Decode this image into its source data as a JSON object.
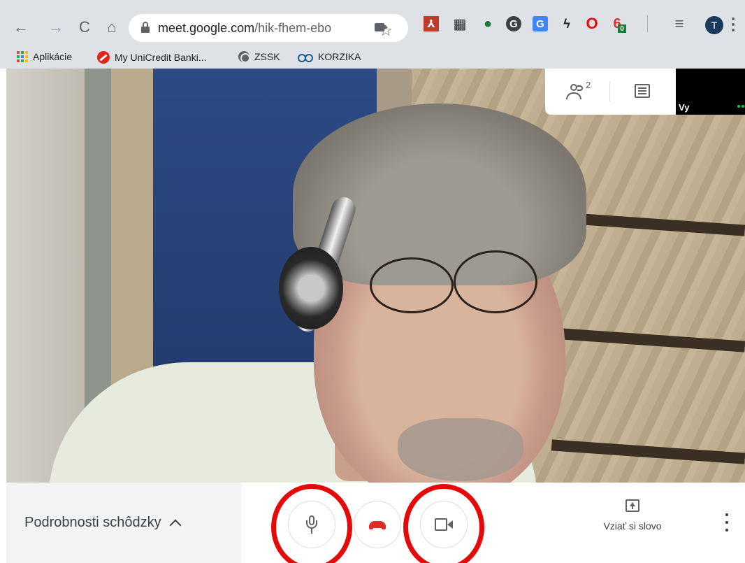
{
  "browser": {
    "url_host": "meet.google.com",
    "url_path": "/hik-fhem-ebo",
    "profile_initial": "T",
    "extensions": [
      {
        "name": "pdf-extension-icon",
        "color": "#c0392b",
        "glyph": "⅄"
      },
      {
        "name": "grid-extension-icon",
        "color": "#202124",
        "glyph": "▦"
      },
      {
        "name": "map-pin-extension-icon",
        "color": "#188038",
        "glyph": "●"
      },
      {
        "name": "grammarly-extension-icon",
        "color": "#3c4043",
        "glyph": "G"
      },
      {
        "name": "translate-extension-icon",
        "color": "#4285f4",
        "glyph": "G"
      },
      {
        "name": "bolt-extension-icon",
        "color": "#202124",
        "glyph": "ϟ"
      },
      {
        "name": "opera-extension-icon",
        "color": "#e50a0a",
        "glyph": "O"
      },
      {
        "name": "lock-extension-icon",
        "color": "#d93025",
        "glyph": "6"
      },
      {
        "name": "media-queue-icon",
        "color": "#5f6368",
        "glyph": "≡"
      }
    ],
    "extension_badge": "0"
  },
  "bookmarks": [
    {
      "label": "Aplikácie"
    },
    {
      "label": "My UniCredit Banki..."
    },
    {
      "label": "ZSSK"
    },
    {
      "label": "KORZIKA"
    }
  ],
  "meet": {
    "participant_count": "2",
    "self_label": "Vy",
    "meeting_details_label": "Podrobnosti schôdzky",
    "present_label": "Vziať si slovo"
  },
  "colors": {
    "highlight": "#e50a0a",
    "hangup": "#d93025"
  }
}
